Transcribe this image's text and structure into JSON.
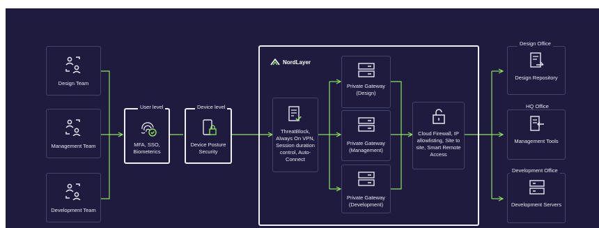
{
  "colors": {
    "background": "#1e1b3f",
    "connector": "#8de55a",
    "box_border": "#44456d",
    "white_border": "#eef0f7",
    "text": "#e6e7f2",
    "accent": "#8de55a"
  },
  "teams": [
    {
      "label": "Design Team",
      "icon": "users-icon"
    },
    {
      "label": "Management Team",
      "icon": "users-icon"
    },
    {
      "label": "Development Team",
      "icon": "users-icon"
    }
  ],
  "user_level": {
    "header": "User level",
    "text": "MFA, SSO, Biometerics",
    "icon": "fingerprint-check-icon"
  },
  "device_level": {
    "header": "Device level",
    "text": "Device Posture Security",
    "icon": "phone-lock-icon"
  },
  "nordlayer": {
    "logo": "NordLayer"
  },
  "threatblock": {
    "text": "ThreatBlock, Always On VPN, Session duration control, Auto-Connect",
    "icon": "document-check-icon"
  },
  "gateways": [
    {
      "line1": "Private Gateway",
      "line2": "(Design)",
      "icon": "server-icon"
    },
    {
      "line1": "Private Gateway",
      "line2": "(Management)",
      "icon": "server-icon"
    },
    {
      "line1": "Private Gateway",
      "line2": "(Development)",
      "icon": "server-icon"
    }
  ],
  "firewall": {
    "text": "Cloud Firewall, IP allowlisting, Site to site, Smart Remote Access",
    "icon": "unlock-icon"
  },
  "offices": [
    {
      "header": "Design Office",
      "text": "Design Repository",
      "icon": "document-edit-icon"
    },
    {
      "header": "HQ Office",
      "text": "Management Tools",
      "icon": "document-arrow-icon"
    },
    {
      "header": "Development Office",
      "text": "Development Servers",
      "icon": "server-icon"
    }
  ]
}
